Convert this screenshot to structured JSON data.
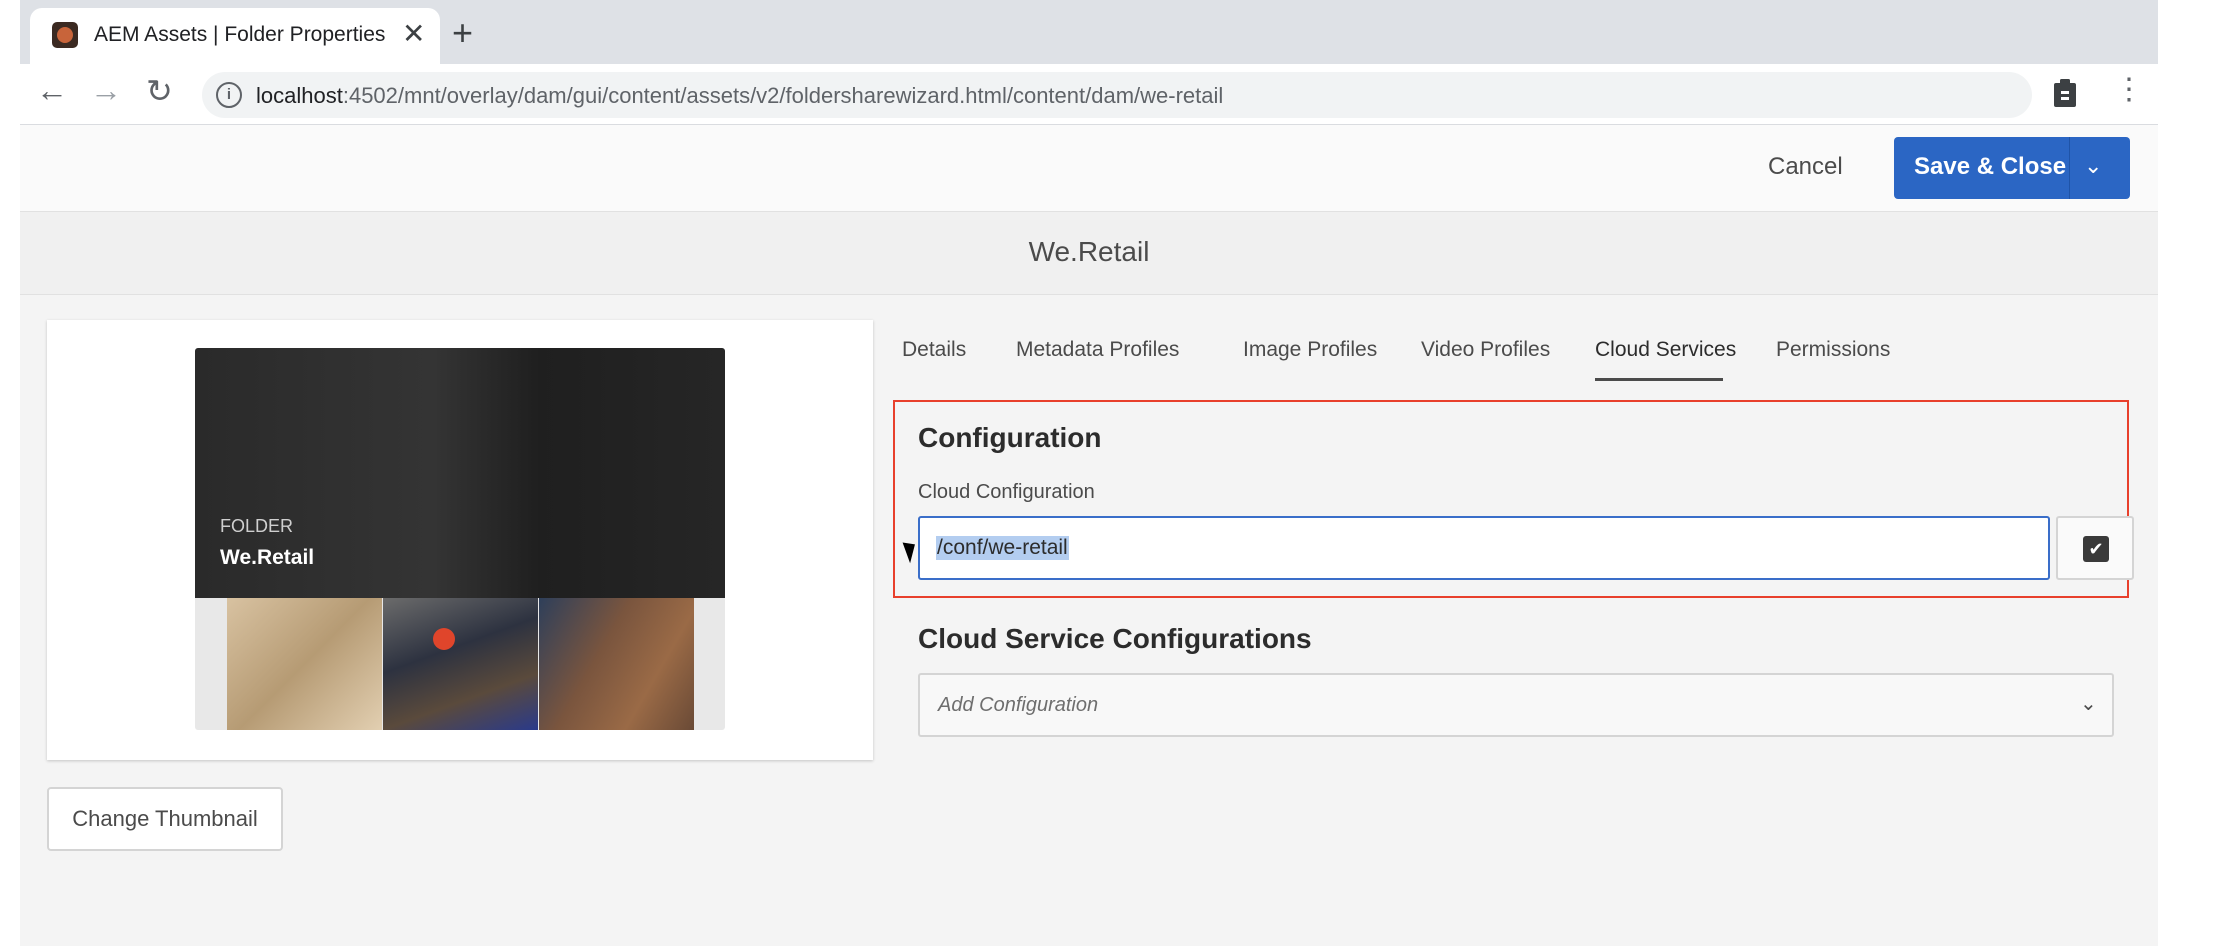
{
  "browser": {
    "tab_title": "AEM Assets | Folder Properties",
    "close_glyph": "✕",
    "new_tab_glyph": "+",
    "back_glyph": "←",
    "forward_glyph": "→",
    "reload_glyph": "↻",
    "menu_glyph": "⋮",
    "url_host": "localhost",
    "url_rest": ":4502/mnt/overlay/dam/gui/content/assets/v2/foldersharewizard.html/content/dam/we-retail"
  },
  "actions": {
    "cancel_label": "Cancel",
    "save_label": "Save & Close",
    "save_menu_glyph": "⌄"
  },
  "page": {
    "title": "We.Retail"
  },
  "card": {
    "kind": "FOLDER",
    "name": "We.Retail",
    "change_thumbnail_label": "Change Thumbnail"
  },
  "tabs": [
    {
      "label": "Details"
    },
    {
      "label": "Metadata Profiles"
    },
    {
      "label": "Image Profiles"
    },
    {
      "label": "Video Profiles"
    },
    {
      "label": "Cloud Services",
      "selected": true
    },
    {
      "label": "Permissions"
    }
  ],
  "configuration": {
    "heading": "Configuration",
    "field_label": "Cloud Configuration",
    "field_value": "/conf/we-retail",
    "picker_glyph": "✔"
  },
  "cloud_services": {
    "heading": "Cloud Service Configurations",
    "placeholder": "Add Configuration",
    "chevron_glyph": "⌄"
  },
  "colors": {
    "accent": "#2b66c4",
    "highlight_border": "#e8402c",
    "selection": "#b3cdf0"
  }
}
